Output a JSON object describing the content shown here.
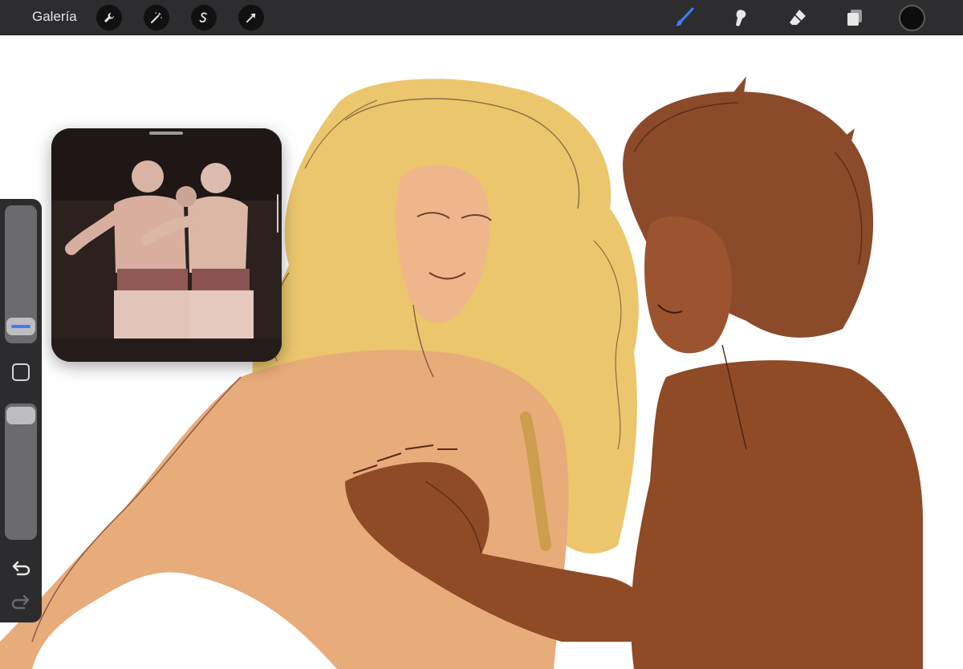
{
  "toolbar": {
    "gallery_label": "Galería",
    "left_tools": [
      "wrench-icon",
      "magic-wand-icon",
      "selection-icon",
      "transform-arrow-icon"
    ],
    "right_tools": [
      "brush-icon",
      "smudge-icon",
      "eraser-icon",
      "layers-icon"
    ],
    "active_tool": "brush-icon",
    "active_color": "#3b7df5",
    "current_color": "#0d0d0d"
  },
  "sidebar": {
    "brush_size_level": 0.2,
    "opacity_level": 0.92,
    "accent_color": "#3b7df5"
  },
  "reference_window": {
    "visible": true
  }
}
